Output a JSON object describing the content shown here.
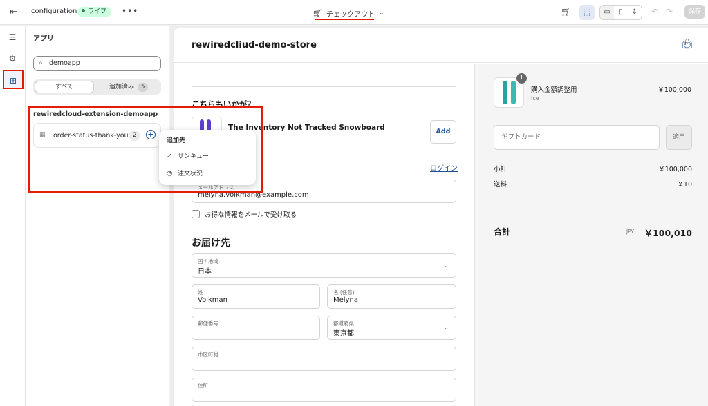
{
  "topbar": {
    "title": "configuration",
    "status_badge": "ライブ",
    "more": "•••",
    "page_selector": "チェックアウト",
    "save_label": "保存"
  },
  "apps_panel": {
    "header": "アプリ",
    "search_value": "demoapp",
    "tab_all": "すべて",
    "tab_added": "追加済み",
    "tab_added_count": "5",
    "app_title": "rewiredcloud-extension-demoapp",
    "extension": {
      "label": "order-status-thank-you",
      "count": "2"
    }
  },
  "popover": {
    "header": "追加先",
    "items": [
      {
        "label": "サンキュー",
        "icon": "check-circle-icon"
      },
      {
        "label": "注文状況",
        "icon": "progress-icon"
      }
    ]
  },
  "preview": {
    "store_name": "rewiredcliud-demo-store",
    "recommend_heading": "こちらもいかが？",
    "product_name": "The Inventory Not Tracked Snowboard",
    "add_label": "Add",
    "login_label": "ログイン",
    "email_label": "メールアドレス",
    "email_value": "melyna.volkman@example.com",
    "newsletter_label": "お得な情報をメールで受け取る",
    "shipping_heading": "お届け先",
    "country_label": "国 / 地域",
    "country_value": "日本",
    "lastname_label": "姓",
    "lastname_value": "Volkman",
    "firstname_label": "名 (任意)",
    "firstname_value": "Melyna",
    "postal_label": "郵便番号",
    "prefecture_label": "都道府県",
    "prefecture_value": "東京都",
    "city_label": "市区町村",
    "address_label": "住所"
  },
  "summary": {
    "qty": "1",
    "item_name": "購入金額調整用",
    "item_variant": "Ice",
    "item_price": "￥100,000",
    "gift_placeholder": "ギフトカード",
    "apply_label": "適用",
    "subtotal_label": "小計",
    "subtotal_value": "￥100,000",
    "shipping_label": "送料",
    "shipping_value": "￥10",
    "total_label": "合計",
    "currency": "JPY",
    "total_value": "￥100,010"
  },
  "colors": {
    "accent": "#1f5199",
    "highlight": "#e51c00",
    "live_badge_bg": "#cdfee1"
  }
}
